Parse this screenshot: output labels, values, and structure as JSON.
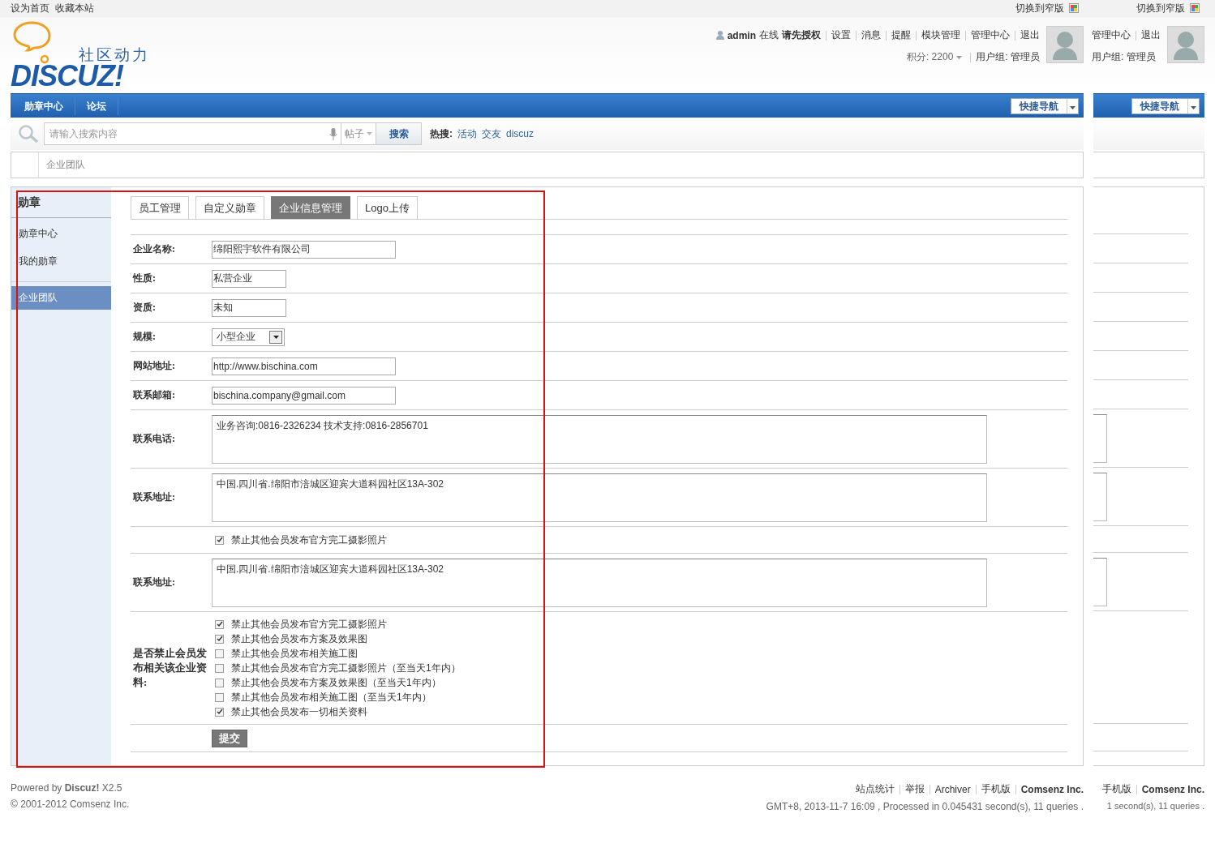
{
  "topbar": {
    "links": [
      "设为首页",
      "收藏本站"
    ],
    "narrow_switch": "切换到窄版"
  },
  "logo": {
    "tagline": "社区动力",
    "wordmark": "DISCUZ!"
  },
  "user": {
    "name": "admin",
    "status": "在线",
    "authorize": "请先授权",
    "links": [
      "设置",
      "消息",
      "提醒",
      "模块管理",
      "管理中心",
      "退出"
    ],
    "points": "积分: 2200",
    "usergroup": "用户组: 管理员"
  },
  "nav": {
    "items": [
      "勋章中心",
      "论坛"
    ],
    "quick_nav": "快捷导航"
  },
  "search": {
    "placeholder": "请输入搜索内容",
    "type": "帖子",
    "button": "搜索",
    "hot_label": "热搜:",
    "hot": [
      "活动",
      "交友",
      "discuz"
    ]
  },
  "breadcrumb": "企业团队",
  "sidebar": {
    "title": "勋章",
    "items": [
      {
        "label": "勋章中心",
        "selected": false
      },
      {
        "label": "我的勋章",
        "selected": false
      },
      {
        "label": "企业团队",
        "selected": true
      }
    ]
  },
  "tabs": [
    {
      "label": "员工管理",
      "selected": false
    },
    {
      "label": "自定义勋章",
      "selected": false
    },
    {
      "label": "企业信息管理",
      "selected": true
    },
    {
      "label": "Logo上传",
      "selected": false
    }
  ],
  "form": [
    {
      "kind": "input",
      "label": "企业名称:",
      "value": "绵阳熙宇软件有限公司",
      "wide": true
    },
    {
      "kind": "input",
      "label": "性质:",
      "value": "私营企业",
      "wide": false
    },
    {
      "kind": "input",
      "label": "资质:",
      "value": "未知",
      "wide": false
    },
    {
      "kind": "select",
      "label": "规模:",
      "value": "小型企业"
    },
    {
      "kind": "input",
      "label": "网站地址:",
      "value": "http://www.bischina.com",
      "wide": true
    },
    {
      "kind": "input",
      "label": "联系邮箱:",
      "value": "bischina.company@gmail.com",
      "wide": true
    },
    {
      "kind": "textarea",
      "label": "联系电话:",
      "value": "业务咨询:0816-2326234 技术支持:0816-2856701"
    },
    {
      "kind": "textarea",
      "label": "联系地址:",
      "value": "中国.四川省.绵阳市涪城区迎宾大道科园社区13A-302"
    },
    {
      "kind": "glitch",
      "options": [
        {
          "label": "禁止其他会员发布官方完工摄影照片",
          "checked": true
        }
      ]
    },
    {
      "kind": "textarea",
      "label": "联系地址:",
      "value": "中国.四川省.绵阳市涪城区迎宾大道科园社区13A-302"
    },
    {
      "kind": "checkboxes",
      "label": "是否禁止会员发布相关该企业资料:",
      "options": [
        {
          "label": "禁止其他会员发布官方完工摄影照片",
          "checked": true
        },
        {
          "label": "禁止其他会员发布方案及效果图",
          "checked": true
        },
        {
          "label": "禁止其他会员发布相关施工图",
          "checked": false
        },
        {
          "label": "禁止其他会员发布官方完工摄影照片（至当天1年内）",
          "checked": false
        },
        {
          "label": "禁止其他会员发布方案及效果图（至当天1年内）",
          "checked": false
        },
        {
          "label": "禁止其他会员发布相关施工图（至当天1年内）",
          "checked": false
        },
        {
          "label": "禁止其他会员发布一切相关资料",
          "checked": true
        }
      ]
    },
    {
      "kind": "submit",
      "button": "提交"
    }
  ],
  "footer": {
    "powered": "Powered by **Discuz!** X2.5",
    "copyright": "© 2001-2012 Comsenz Inc.",
    "links": [
      "站点统计",
      "举报",
      "Archiver",
      "手机版"
    ],
    "company": "Comsenz Inc.",
    "stats": "GMT+8, 2013-11-7 16:09 , Processed in 0.045431 second(s), 11 queries ."
  },
  "ghost": {
    "narrow_switch": "切换到窄版",
    "links": [
      "管理中心",
      "退出"
    ],
    "usergroup": "用户组: 管理员",
    "quick_nav": "快捷导航",
    "footer_links": [
      "手机版"
    ],
    "company": "Comsenz Inc.",
    "stats": "1 second(s), 11 queries ."
  }
}
